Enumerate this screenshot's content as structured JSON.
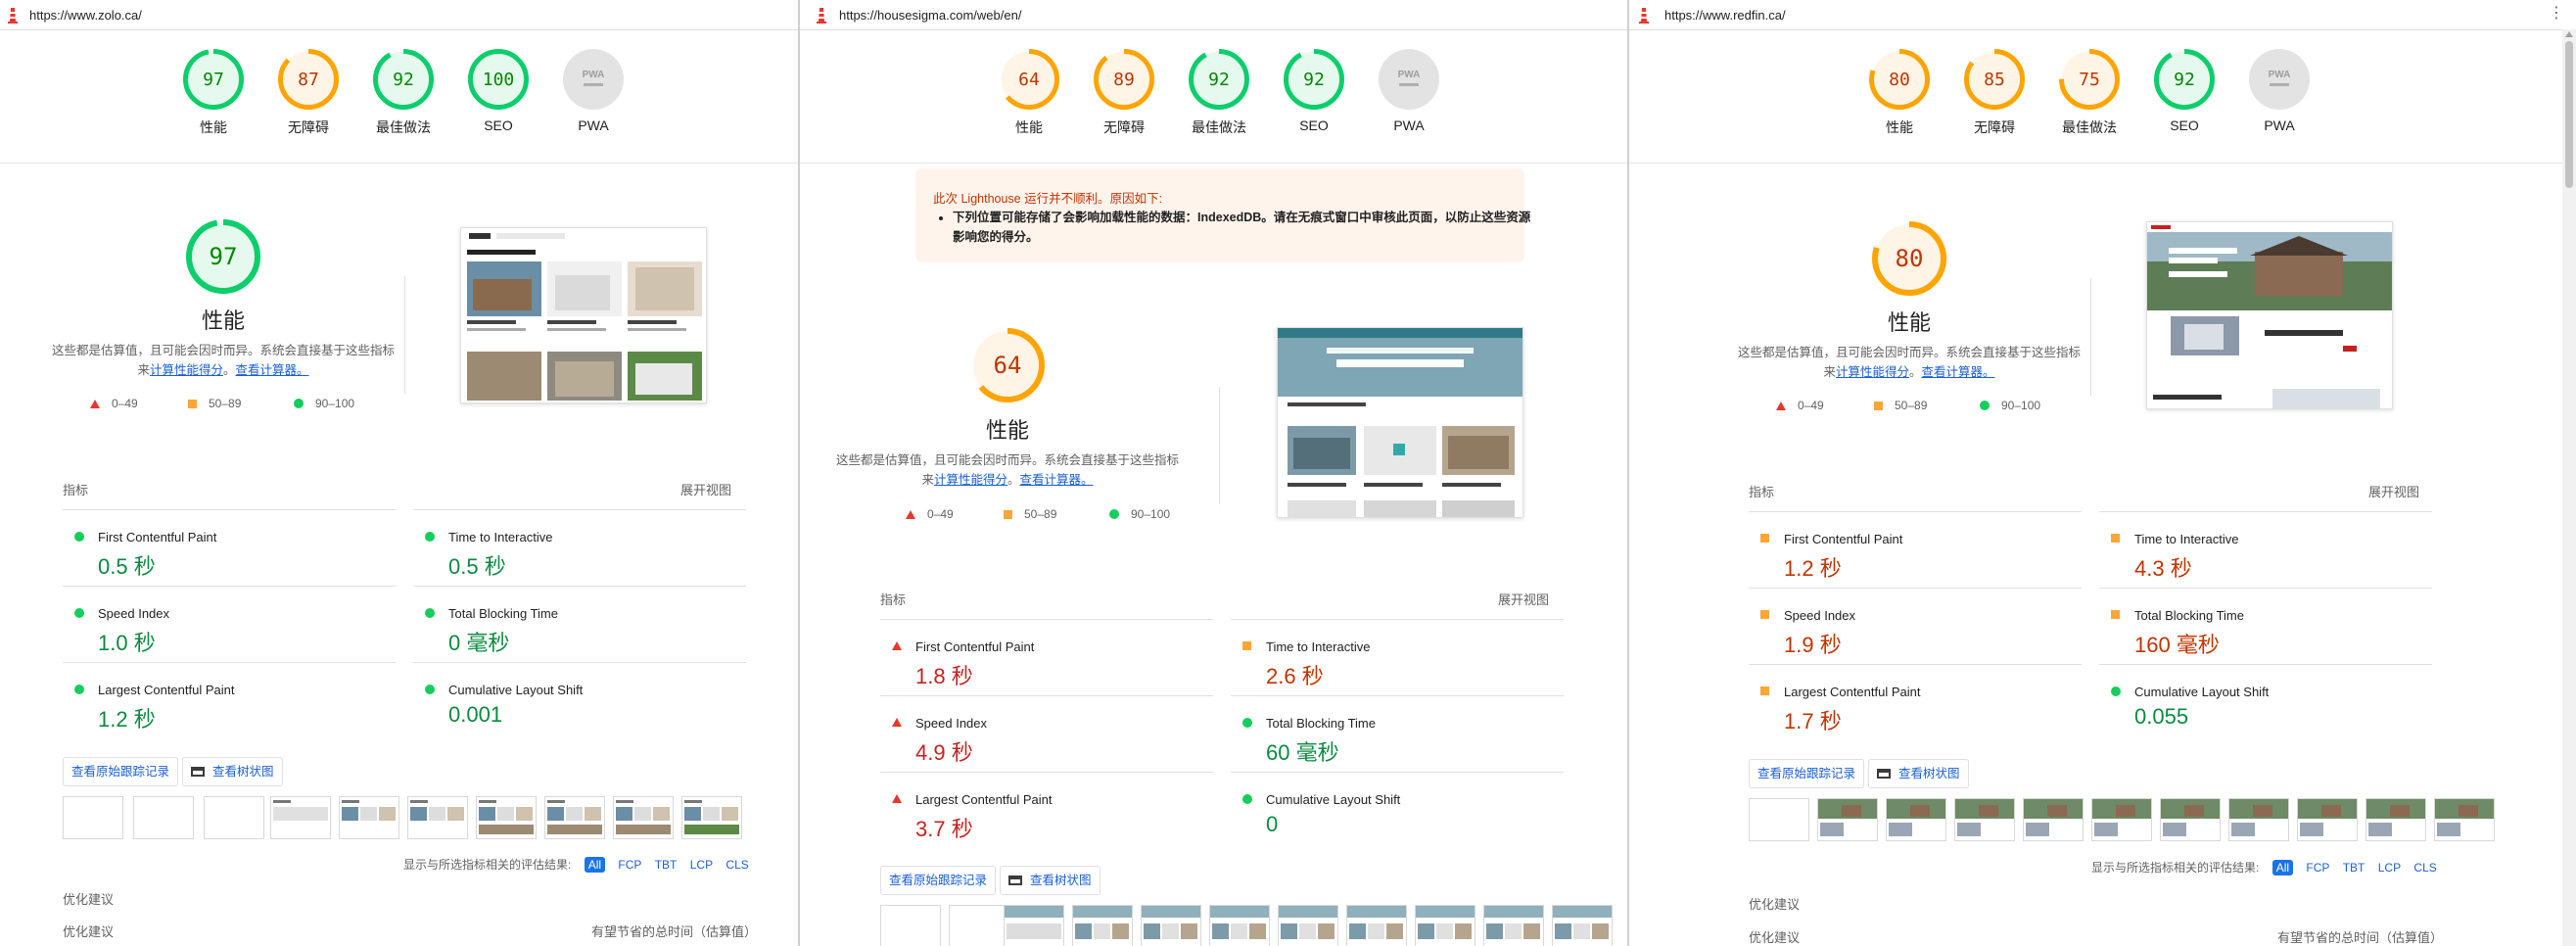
{
  "panels": [
    {
      "url": "https://www.zolo.ca/",
      "gauges": [
        {
          "label": "性能",
          "score": "97",
          "value": 97,
          "rating": "good"
        },
        {
          "label": "无障碍",
          "score": "87",
          "value": 87,
          "rating": "avg"
        },
        {
          "label": "最佳做法",
          "score": "92",
          "value": 92,
          "rating": "good"
        },
        {
          "label": "SEO",
          "score": "100",
          "value": 100,
          "rating": "good"
        },
        {
          "label": "PWA",
          "score": "",
          "value": 0,
          "rating": "pwa"
        }
      ],
      "warning": null,
      "performance": {
        "score": "97",
        "value": 97,
        "rating": "good",
        "title": "性能",
        "desc_prefix": "这些都是估算值，且可能会因时而异。系统会直接基于这些指标来",
        "link1": "计算性能得分",
        "sep": "。",
        "link2": "查看计算器。"
      },
      "legend": {
        "fail": "0–49",
        "avg": "50–89",
        "pass": "90–100"
      },
      "metrics_heading": "指标",
      "expand_label": "展开视图",
      "metrics": [
        {
          "name": "First Contentful Paint",
          "value": "0.5 秒",
          "rating": "good"
        },
        {
          "name": "Time to Interactive",
          "value": "0.5 秒",
          "rating": "good"
        },
        {
          "name": "Speed Index",
          "value": "1.0 秒",
          "rating": "good"
        },
        {
          "name": "Total Blocking Time",
          "value": "0 毫秒",
          "rating": "good"
        },
        {
          "name": "Largest Contentful Paint",
          "value": "1.2 秒",
          "rating": "good"
        },
        {
          "name": "Cumulative Layout Shift",
          "value": "0.001",
          "rating": "good"
        }
      ],
      "trace_label": "查看原始跟踪记录",
      "treemap_label": "查看树状图",
      "filter_label": "显示与所选指标相关的评估结果:",
      "filters": [
        "All",
        "FCP",
        "TBT",
        "LCP",
        "CLS"
      ],
      "section1": "优化建议",
      "section2": "优化建议",
      "section2_right": ""
    },
    {
      "url": "https://housesigma.com/web/en/",
      "gauges": [
        {
          "label": "性能",
          "score": "64",
          "value": 64,
          "rating": "avg"
        },
        {
          "label": "无障碍",
          "score": "89",
          "value": 89,
          "rating": "avg"
        },
        {
          "label": "最佳做法",
          "score": "92",
          "value": 92,
          "rating": "good"
        },
        {
          "label": "SEO",
          "score": "92",
          "value": 92,
          "rating": "good"
        },
        {
          "label": "PWA",
          "score": "",
          "value": 0,
          "rating": "pwa"
        }
      ],
      "warning": {
        "title": "此次 Lighthouse 运行并不顺利。原因如下:",
        "item": "下列位置可能存储了会影响加载性能的数据：IndexedDB。请在无痕式窗口中审核此页面，以防止这些资源影响您的得分。"
      },
      "performance": {
        "score": "64",
        "value": 64,
        "rating": "avg",
        "title": "性能",
        "desc_prefix": "这些都是估算值，且可能会因时而异。系统会直接基于这些指标来",
        "link1": "计算性能得分",
        "sep": "。",
        "link2": "查看计算器。"
      },
      "legend": {
        "fail": "0–49",
        "avg": "50–89",
        "pass": "90–100"
      },
      "metrics_heading": "指标",
      "expand_label": "展开视图",
      "metrics": [
        {
          "name": "First Contentful Paint",
          "value": "1.8 秒",
          "rating": "fail"
        },
        {
          "name": "Time to Interactive",
          "value": "2.6 秒",
          "rating": "avg"
        },
        {
          "name": "Speed Index",
          "value": "4.9 秒",
          "rating": "fail"
        },
        {
          "name": "Total Blocking Time",
          "value": "60 毫秒",
          "rating": "good"
        },
        {
          "name": "Largest Contentful Paint",
          "value": "3.7 秒",
          "rating": "fail"
        },
        {
          "name": "Cumulative Layout Shift",
          "value": "0",
          "rating": "good"
        }
      ],
      "trace_label": "查看原始跟踪记录",
      "treemap_label": "查看树状图",
      "filter_label": "",
      "filters": [],
      "section1": "",
      "section2": "",
      "section2_right": ""
    },
    {
      "url": "https://www.redfin.ca/",
      "gauges": [
        {
          "label": "性能",
          "score": "80",
          "value": 80,
          "rating": "avg"
        },
        {
          "label": "无障碍",
          "score": "85",
          "value": 85,
          "rating": "avg"
        },
        {
          "label": "最佳做法",
          "score": "75",
          "value": 75,
          "rating": "avg"
        },
        {
          "label": "SEO",
          "score": "92",
          "value": 92,
          "rating": "good"
        },
        {
          "label": "PWA",
          "score": "",
          "value": 0,
          "rating": "pwa"
        }
      ],
      "warning": null,
      "performance": {
        "score": "80",
        "value": 80,
        "rating": "avg",
        "title": "性能",
        "desc_prefix": "这些都是估算值，且可能会因时而异。系统会直接基于这些指标来",
        "link1": "计算性能得分",
        "sep": "。",
        "link2": "查看计算器。"
      },
      "legend": {
        "fail": "0–49",
        "avg": "50–89",
        "pass": "90–100"
      },
      "metrics_heading": "指标",
      "expand_label": "展开视图",
      "metrics": [
        {
          "name": "First Contentful Paint",
          "value": "1.2 秒",
          "rating": "avg"
        },
        {
          "name": "Time to Interactive",
          "value": "4.3 秒",
          "rating": "avg"
        },
        {
          "name": "Speed Index",
          "value": "1.9 秒",
          "rating": "avg"
        },
        {
          "name": "Total Blocking Time",
          "value": "160 毫秒",
          "rating": "avg"
        },
        {
          "name": "Largest Contentful Paint",
          "value": "1.7 秒",
          "rating": "avg"
        },
        {
          "name": "Cumulative Layout Shift",
          "value": "0.055",
          "rating": "good"
        }
      ],
      "trace_label": "查看原始跟踪记录",
      "treemap_label": "查看树状图",
      "filter_label": "显示与所选指标相关的评估结果:",
      "filters": [
        "All",
        "FCP",
        "TBT",
        "LCP",
        "CLS"
      ],
      "section1": "优化建议",
      "section2": "优化建议",
      "section2_right": "有望节省的总时间（估算值）"
    }
  ],
  "panel0_section2_right": "有望节省的总时间（估算值）",
  "colors": {
    "good": "#0cce6b",
    "avg": "#ffa400",
    "fail": "#ff4e42",
    "good_text": "#008800",
    "avg_text": "#c33300",
    "fail_text": "#cc0000",
    "link": "#1a5fd8"
  }
}
